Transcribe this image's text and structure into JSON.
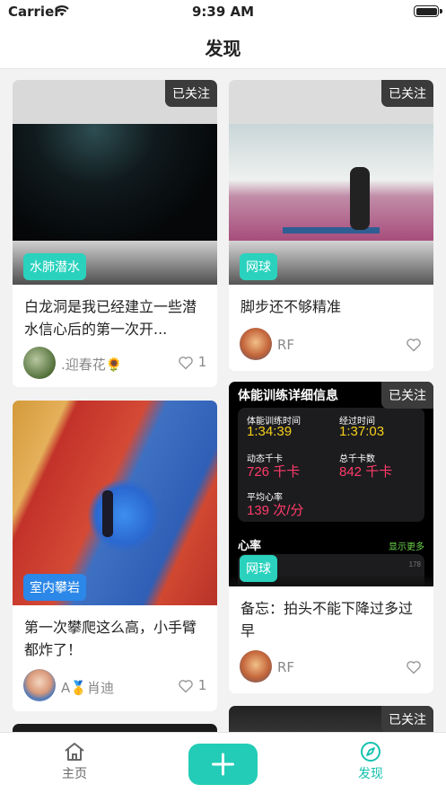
{
  "status_bar": {
    "carrier": "Carrier",
    "time": "9:39 AM"
  },
  "nav": {
    "title": "发现"
  },
  "follow_label": "已关注",
  "cards": [
    {
      "tag": "水肺潜水",
      "title": "白龙洞是我已经建立一些潜水信心后的第一次开...",
      "author": ".迎春花🌻",
      "likes": "1"
    },
    {
      "tag": "网球",
      "title": "脚步还不够精准",
      "author": "RF"
    },
    {
      "tag": "室内攀岩",
      "title": "第一次攀爬这么高，小手臂都炸了！",
      "author": "A🥇肖迪",
      "likes": "1"
    },
    {
      "tag": "网球",
      "title": "备忘：拍头不能下降过多过早",
      "author": "RF",
      "workout": {
        "header": "体能训练详细信息",
        "training_time_label": "体能训练时间",
        "training_time": "1:34:39",
        "elapsed_label": "经过时间",
        "elapsed": "1:37:03",
        "active_kcal_label": "动态千卡",
        "active_kcal": "726 千卡",
        "total_kcal_label": "总千卡数",
        "total_kcal": "842 千卡",
        "avg_hr_label": "平均心率",
        "avg_hr": "139 次/分",
        "hr_label": "心率",
        "show_more": "显示更多",
        "hr_axis": "178"
      }
    }
  ],
  "tab_bar": {
    "home": "主页",
    "discover": "发现"
  },
  "colors": {
    "accent": "#23ccb6",
    "tag_teal": "#2ad2be",
    "tag_blue": "#2b87e8",
    "follow_bg": "#3b3b3b"
  }
}
